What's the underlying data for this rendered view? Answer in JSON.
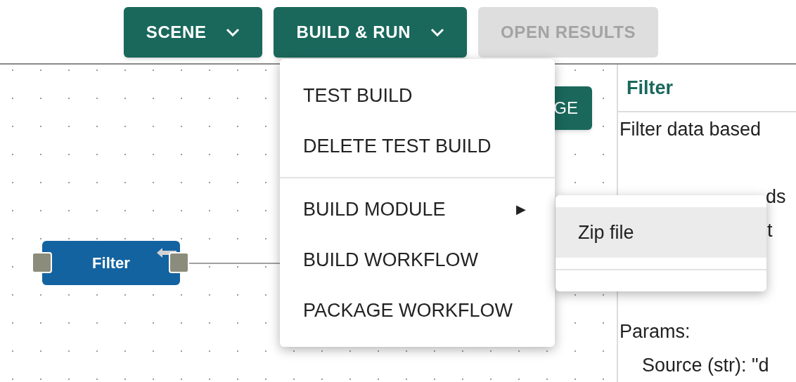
{
  "toolbar": {
    "buttons": [
      {
        "label": "SCENE",
        "kind": "dropdown",
        "disabled": false
      },
      {
        "label": "BUILD & RUN",
        "kind": "dropdown",
        "disabled": false
      },
      {
        "label": "OPEN RESULTS",
        "kind": "plain",
        "disabled": true
      }
    ]
  },
  "canvas": {
    "partial_button": "GE",
    "nodes": [
      {
        "label": "Filter"
      }
    ]
  },
  "build_menu": {
    "items": [
      {
        "kind": "item",
        "label": "TEST BUILD"
      },
      {
        "kind": "item",
        "label": "DELETE TEST BUILD"
      },
      {
        "kind": "divider"
      },
      {
        "kind": "submenu",
        "label": "BUILD MODULE",
        "arrow": "▶"
      },
      {
        "kind": "item",
        "label": "BUILD WORKFLOW"
      },
      {
        "kind": "item",
        "label": "PACKAGE WORKFLOW"
      }
    ]
  },
  "submenu": {
    "items": [
      {
        "kind": "item",
        "label": "Zip file",
        "selected": true
      },
      {
        "kind": "divider"
      }
    ]
  },
  "panel": {
    "title": "Filter",
    "lines": [
      {
        "kind": "text",
        "text": "Filter data based"
      },
      {
        "kind": "blank"
      },
      {
        "kind": "fragment",
        "text": "ds"
      },
      {
        "kind": "fragment",
        "text": "t"
      },
      {
        "kind": "blank"
      },
      {
        "kind": "blank"
      },
      {
        "kind": "text",
        "text": "Params:"
      },
      {
        "kind": "indented",
        "text": "Source (str): \"d"
      }
    ]
  }
}
